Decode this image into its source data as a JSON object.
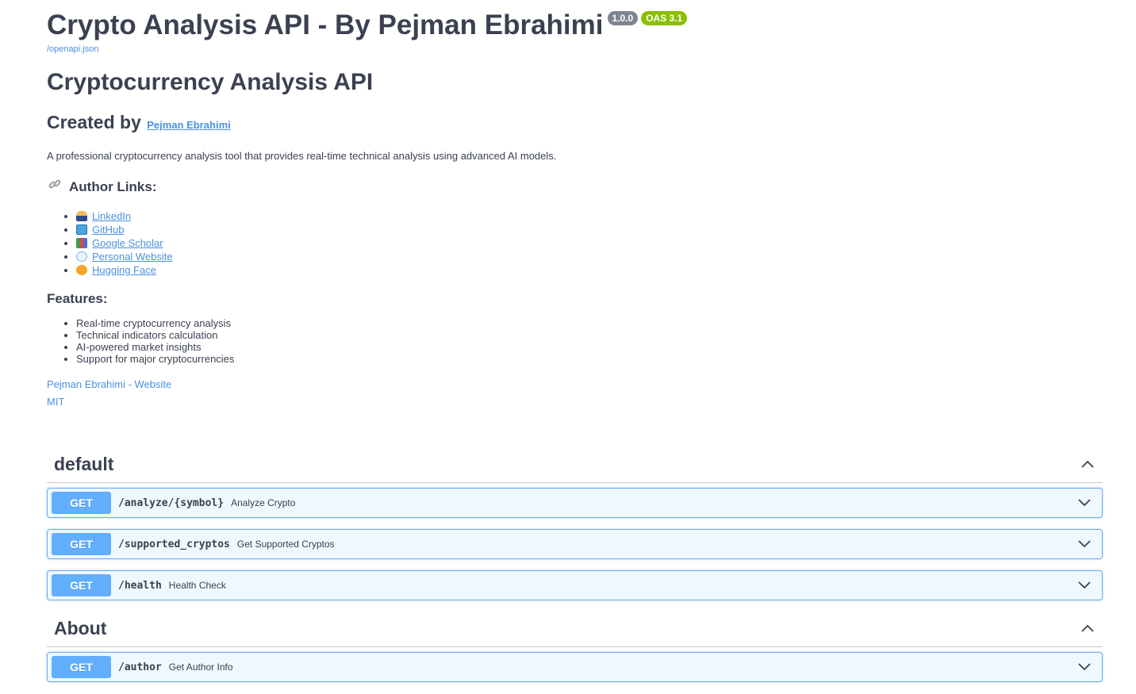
{
  "header": {
    "title": "Crypto Analysis API - By Pejman Ebrahimi",
    "version_badge": "1.0.0",
    "oas_badge": "OAS 3.1",
    "spec_link": "/openapi.json"
  },
  "info": {
    "api_name": "Cryptocurrency Analysis API",
    "created_by_label": "Created by",
    "created_by_link": "Pejman Ebrahimi",
    "description": "A professional cryptocurrency analysis tool that provides real-time technical analysis using advanced AI models.",
    "author_links_heading": "Author Links:",
    "author_links": [
      {
        "label": "LinkedIn",
        "icon": "person-icon"
      },
      {
        "label": "GitHub",
        "icon": "computer-icon"
      },
      {
        "label": "Google Scholar",
        "icon": "books-icon"
      },
      {
        "label": "Personal Website",
        "icon": "globe-icon"
      },
      {
        "label": "Hugging Face",
        "icon": "hugging-face-icon"
      }
    ],
    "features_heading": "Features:",
    "features": [
      "Real-time cryptocurrency analysis",
      "Technical indicators calculation",
      "AI-powered market insights",
      "Support for major cryptocurrencies"
    ],
    "website_link": "Pejman Ebrahimi - Website",
    "license_link": "MIT"
  },
  "tags": [
    {
      "name": "default",
      "operations": [
        {
          "method": "GET",
          "path": "/analyze/{symbol}",
          "summary": "Analyze Crypto"
        },
        {
          "method": "GET",
          "path": "/supported_cryptos",
          "summary": "Get Supported Cryptos"
        },
        {
          "method": "GET",
          "path": "/health",
          "summary": "Health Check"
        }
      ]
    },
    {
      "name": "About",
      "operations": [
        {
          "method": "GET",
          "path": "/author",
          "summary": "Get Author Info"
        }
      ]
    }
  ],
  "colors": {
    "get_method": "#61affe",
    "link": "#4990e2",
    "version_badge": "#7d8492",
    "oas_badge": "#89bf04",
    "text": "#3b4151"
  }
}
